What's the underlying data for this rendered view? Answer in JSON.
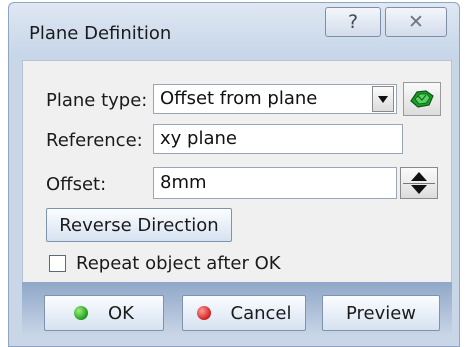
{
  "window": {
    "title": "Plane Definition",
    "help_glyph": "?",
    "close_glyph": "✕"
  },
  "form": {
    "plane_type_label": "Plane type:",
    "plane_type_value": "Offset from plane",
    "reference_label": "Reference:",
    "reference_value": "xy plane",
    "offset_label": "Offset:",
    "offset_value": "8mm",
    "reverse_direction_label": "Reverse Direction",
    "repeat_label": "Repeat object after OK",
    "repeat_checked": false
  },
  "buttons": {
    "ok_label": "OK",
    "cancel_label": "Cancel",
    "preview_label": "Preview"
  },
  "colors": {
    "ok_icon": "#1e9a1e",
    "cancel_icon": "#d21f1f",
    "frame": "#c9d6e7"
  },
  "icons": {
    "plane_tool": "green-plane-icon",
    "ok": "green-dot-icon",
    "cancel": "red-dot-icon"
  }
}
